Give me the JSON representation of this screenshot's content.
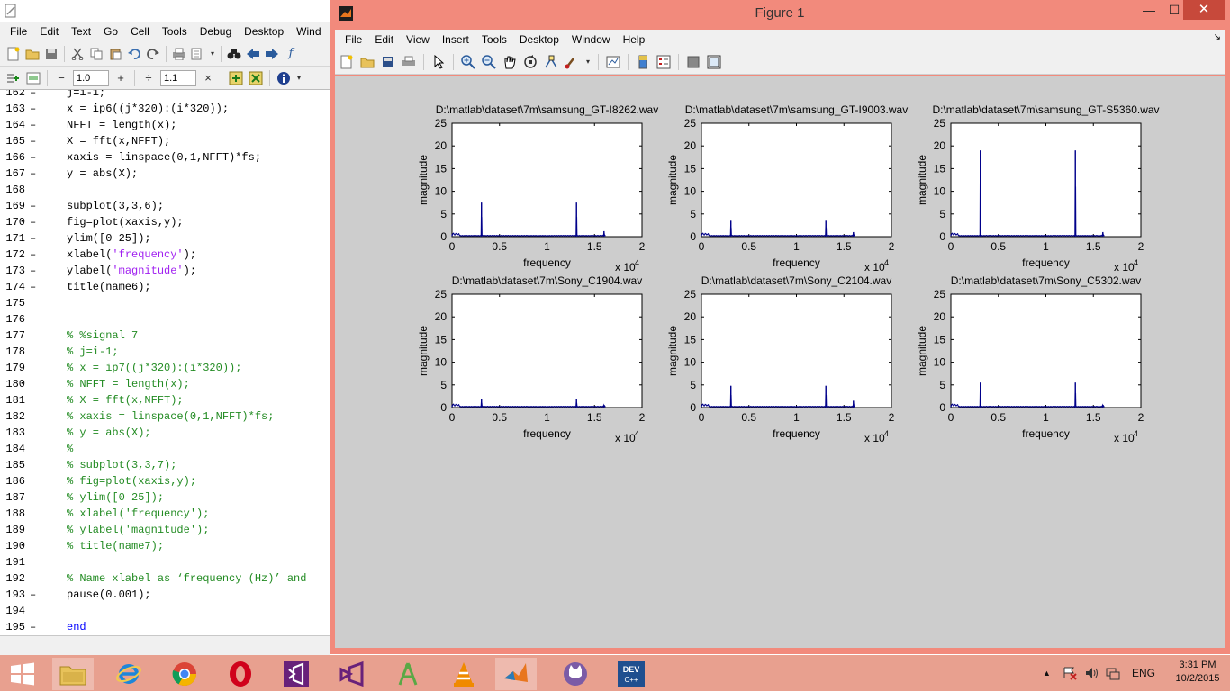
{
  "editor": {
    "menu": [
      "File",
      "Edit",
      "Text",
      "Go",
      "Cell",
      "Tools",
      "Debug",
      "Desktop",
      "Wind"
    ],
    "toolbar2": {
      "value1": "1.0",
      "value2": "1.1"
    },
    "code": [
      {
        "ln": "162",
        "text": "j=i-1;",
        "cls": "",
        "dash": true
      },
      {
        "ln": "163",
        "text": "x = ip6((j*320):(i*320));",
        "cls": "",
        "dash": true
      },
      {
        "ln": "164",
        "text": "NFFT = length(x);",
        "cls": "",
        "dash": true
      },
      {
        "ln": "165",
        "text": "X = fft(x,NFFT);",
        "cls": "",
        "dash": true
      },
      {
        "ln": "166",
        "text": "xaxis = linspace(0,1,NFFT)*fs;",
        "cls": "",
        "dash": true
      },
      {
        "ln": "167",
        "text": "y = abs(X);",
        "cls": "",
        "dash": true
      },
      {
        "ln": "168",
        "text": "",
        "cls": "",
        "dash": false
      },
      {
        "ln": "169",
        "text": "subplot(3,3,6);",
        "cls": "",
        "dash": true
      },
      {
        "ln": "170",
        "text": "fig=plot(xaxis,y);",
        "cls": "",
        "dash": true
      },
      {
        "ln": "171",
        "text": "ylim([0 25]);",
        "cls": "",
        "dash": true
      },
      {
        "ln": "172",
        "text": "xlabel(",
        "str": "'frequency'",
        "after": ");",
        "cls": "",
        "dash": true
      },
      {
        "ln": "173",
        "text": "ylabel(",
        "str": "'magnitude'",
        "after": ");",
        "cls": "",
        "dash": true
      },
      {
        "ln": "174",
        "text": "title(name6);",
        "cls": "",
        "dash": true
      },
      {
        "ln": "175",
        "text": "",
        "cls": "",
        "dash": false
      },
      {
        "ln": "176",
        "text": "",
        "cls": "",
        "dash": false
      },
      {
        "ln": "177",
        "text": "% %signal 7",
        "cls": "cmt",
        "dash": false
      },
      {
        "ln": "178",
        "text": "% j=i-1;",
        "cls": "cmt",
        "dash": false
      },
      {
        "ln": "179",
        "text": "% x = ip7((j*320):(i*320));",
        "cls": "cmt",
        "dash": false
      },
      {
        "ln": "180",
        "text": "% NFFT = length(x);",
        "cls": "cmt",
        "dash": false
      },
      {
        "ln": "181",
        "text": "% X = fft(x,NFFT);",
        "cls": "cmt",
        "dash": false
      },
      {
        "ln": "182",
        "text": "% xaxis = linspace(0,1,NFFT)*fs;",
        "cls": "cmt",
        "dash": false
      },
      {
        "ln": "183",
        "text": "% y = abs(X);",
        "cls": "cmt",
        "dash": false
      },
      {
        "ln": "184",
        "text": "%",
        "cls": "cmt",
        "dash": false
      },
      {
        "ln": "185",
        "text": "% subplot(3,3,7);",
        "cls": "cmt",
        "dash": false
      },
      {
        "ln": "186",
        "text": "% fig=plot(xaxis,y);",
        "cls": "cmt",
        "dash": false
      },
      {
        "ln": "187",
        "text": "% ylim([0 25]);",
        "cls": "cmt",
        "dash": false
      },
      {
        "ln": "188",
        "text": "% xlabel('frequency');",
        "cls": "cmt",
        "dash": false
      },
      {
        "ln": "189",
        "text": "% ylabel('magnitude');",
        "cls": "cmt",
        "dash": false
      },
      {
        "ln": "190",
        "text": "% title(name7);",
        "cls": "cmt",
        "dash": false
      },
      {
        "ln": "191",
        "text": "",
        "cls": "",
        "dash": false
      },
      {
        "ln": "192",
        "text": "% Name xlabel as ‘frequency (Hz)’ and",
        "cls": "cmt",
        "dash": false
      },
      {
        "ln": "193",
        "text": "pause(0.001);",
        "cls": "",
        "dash": true
      },
      {
        "ln": "194",
        "text": "",
        "cls": "",
        "dash": false
      },
      {
        "ln": "195",
        "text": "end",
        "cls": "kw",
        "dash": true
      }
    ]
  },
  "figure": {
    "title": "Figure 1",
    "menu": [
      "File",
      "Edit",
      "View",
      "Insert",
      "Tools",
      "Desktop",
      "Window",
      "Help"
    ],
    "min_glyph": "—",
    "max_glyph": "☐",
    "close_glyph": "✕"
  },
  "chart_data": [
    {
      "type": "line",
      "title": "D:\\matlab\\dataset\\7m\\samsung_GT-I8262.wav",
      "xlabel": "frequency",
      "ylabel": "magnitude",
      "xlim": [
        0,
        20000
      ],
      "ylim": [
        0,
        25
      ],
      "x_exponent_label": "x 10",
      "x_exponent": "4",
      "xticks": [
        "0",
        "0.5",
        "1",
        "1.5",
        "2"
      ],
      "yticks": [
        "0",
        "5",
        "10",
        "15",
        "20",
        "25"
      ],
      "peaks": [
        {
          "x": 3100,
          "y": 7.5
        },
        {
          "x": 13100,
          "y": 7.5
        },
        {
          "x": 16000,
          "y": 1.2
        }
      ]
    },
    {
      "type": "line",
      "title": "D:\\matlab\\dataset\\7m\\samsung_GT-I9003.wav",
      "xlabel": "frequency",
      "ylabel": "magnitude",
      "xlim": [
        0,
        20000
      ],
      "ylim": [
        0,
        25
      ],
      "x_exponent_label": "x 10",
      "x_exponent": "4",
      "xticks": [
        "0",
        "0.5",
        "1",
        "1.5",
        "2"
      ],
      "yticks": [
        "0",
        "5",
        "10",
        "15",
        "20",
        "25"
      ],
      "peaks": [
        {
          "x": 3100,
          "y": 3.5
        },
        {
          "x": 13100,
          "y": 3.5
        },
        {
          "x": 16000,
          "y": 1.0
        }
      ]
    },
    {
      "type": "line",
      "title": "D:\\matlab\\dataset\\7m\\samsung_GT-S5360.wav",
      "xlabel": "frequency",
      "ylabel": "magnitude",
      "xlim": [
        0,
        20000
      ],
      "ylim": [
        0,
        25
      ],
      "x_exponent_label": "x 10",
      "x_exponent": "4",
      "xticks": [
        "0",
        "0.5",
        "1",
        "1.5",
        "2"
      ],
      "yticks": [
        "0",
        "5",
        "10",
        "15",
        "20",
        "25"
      ],
      "peaks": [
        {
          "x": 3100,
          "y": 19
        },
        {
          "x": 13100,
          "y": 19
        },
        {
          "x": 16000,
          "y": 1.0
        }
      ]
    },
    {
      "type": "line",
      "title": "D:\\matlab\\dataset\\7m\\Sony_C1904.wav",
      "xlabel": "frequency",
      "ylabel": "magnitude",
      "xlim": [
        0,
        20000
      ],
      "ylim": [
        0,
        25
      ],
      "x_exponent_label": "x 10",
      "x_exponent": "4",
      "xticks": [
        "0",
        "0.5",
        "1",
        "1.5",
        "2"
      ],
      "yticks": [
        "0",
        "5",
        "10",
        "15",
        "20",
        "25"
      ],
      "peaks": [
        {
          "x": 3100,
          "y": 1.8
        },
        {
          "x": 13100,
          "y": 1.8
        },
        {
          "x": 16000,
          "y": 0.5
        }
      ]
    },
    {
      "type": "line",
      "title": "D:\\matlab\\dataset\\7m\\Sony_C2104.wav",
      "xlabel": "frequency",
      "ylabel": "magnitude",
      "xlim": [
        0,
        20000
      ],
      "ylim": [
        0,
        25
      ],
      "x_exponent_label": "x 10",
      "x_exponent": "4",
      "xticks": [
        "0",
        "0.5",
        "1",
        "1.5",
        "2"
      ],
      "yticks": [
        "0",
        "5",
        "10",
        "15",
        "20",
        "25"
      ],
      "peaks": [
        {
          "x": 3100,
          "y": 4.8
        },
        {
          "x": 13100,
          "y": 4.8
        },
        {
          "x": 16000,
          "y": 1.5
        }
      ]
    },
    {
      "type": "line",
      "title": "D:\\matlab\\dataset\\7m\\Sony_C5302.wav",
      "xlabel": "frequency",
      "ylabel": "magnitude",
      "xlim": [
        0,
        20000
      ],
      "ylim": [
        0,
        25
      ],
      "x_exponent_label": "x 10",
      "x_exponent": "4",
      "xticks": [
        "0",
        "0.5",
        "1",
        "1.5",
        "2"
      ],
      "yticks": [
        "0",
        "5",
        "10",
        "15",
        "20",
        "25"
      ],
      "peaks": [
        {
          "x": 3100,
          "y": 5.5
        },
        {
          "x": 13100,
          "y": 5.5
        },
        {
          "x": 16000,
          "y": 0.6
        }
      ]
    }
  ],
  "taskbar": {
    "language": "ENG",
    "time": "3:31 PM",
    "date": "10/2/2015",
    "apps": [
      "start-icon",
      "file-explorer-icon",
      "internet-explorer-icon",
      "chrome-icon",
      "opera-icon",
      "visual-studio-icon",
      "visual-studio-alt-icon",
      "android-studio-icon",
      "vlc-icon",
      "matlab-icon",
      "github-icon",
      "devcpp-icon"
    ]
  },
  "colors": {
    "plot_line": "#00008b",
    "figure_frame": "#f28a7c",
    "canvas": "#cdcdcd",
    "taskbar": "#e8a08f"
  }
}
